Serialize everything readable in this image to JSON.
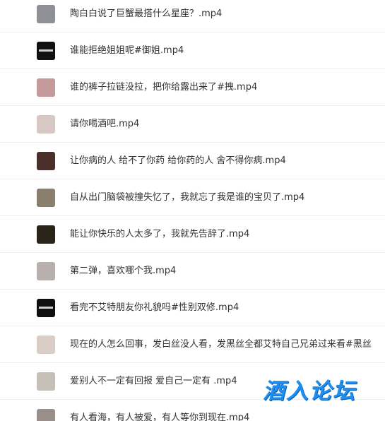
{
  "files": [
    {
      "name": "陶白白说了巨蟹最搭什么星座？.mp4",
      "thumb_color": "#8f8f96",
      "thumb_style": "photo"
    },
    {
      "name": "谁能拒绝姐姐呢#御姐.mp4",
      "thumb_color": "#111111",
      "thumb_style": "dark-logo"
    },
    {
      "name": "谁的裤子拉链没拉，把你给露出来了#拽.mp4",
      "thumb_color": "#c49a9a",
      "thumb_style": "photo"
    },
    {
      "name": "请你喝酒吧.mp4",
      "thumb_color": "#d8c8c4",
      "thumb_style": "photo"
    },
    {
      "name": "让你病的人 给不了你药 给你药的人 舍不得你病.mp4",
      "thumb_color": "#4a2f2a",
      "thumb_style": "photo"
    },
    {
      "name": "自从出门脑袋被撞失忆了，我就忘了我是谁的宝贝了.mp4",
      "thumb_color": "#8a7e6c",
      "thumb_style": "photo"
    },
    {
      "name": "能让你快乐的人太多了，我就先告辞了.mp4",
      "thumb_color": "#2a2418",
      "thumb_style": "photo"
    },
    {
      "name": "第二弹，喜欢哪个我.mp4",
      "thumb_color": "#b9b0ad",
      "thumb_style": "photo"
    },
    {
      "name": "看完不艾特朋友你礼貌吗#性别双修.mp4",
      "thumb_color": "#0f0f0f",
      "thumb_style": "dark-logo"
    },
    {
      "name": "现在的人怎么回事，发白丝没人看，发黑丝全都艾特自己兄弟过来看#黑丝",
      "thumb_color": "#d9cdc6",
      "thumb_style": "photo"
    },
    {
      "name": "爱别人不一定有回报 爱自己一定有 .mp4",
      "thumb_color": "#c6bfb8",
      "thumb_style": "photo"
    },
    {
      "name": "有人看海，有人被爱，有人等你到现在.mp4",
      "thumb_color": "#9a8f8a",
      "thumb_style": "photo"
    }
  ],
  "watermark": {
    "text": "酒入论坛",
    "color": "#1e8ef0"
  }
}
